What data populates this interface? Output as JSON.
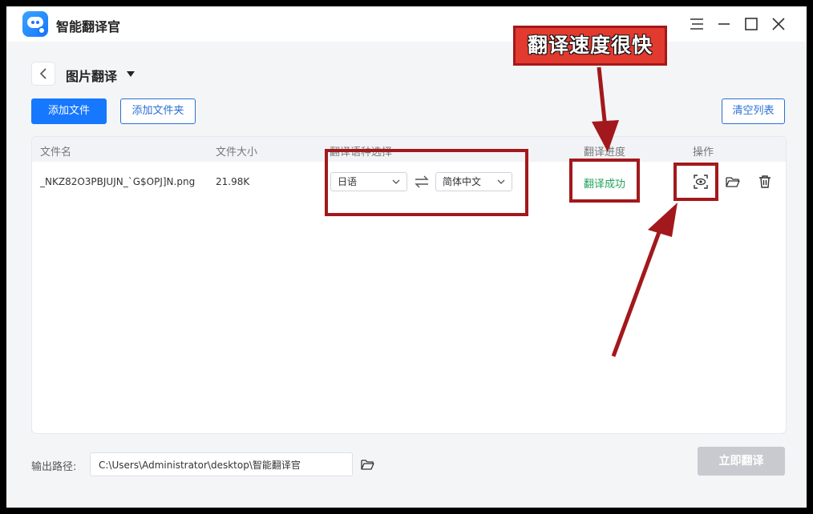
{
  "app": {
    "title": "智能翻译官",
    "window_controls": [
      "menu-icon",
      "minimize-icon",
      "maximize-icon",
      "close-icon"
    ]
  },
  "page": {
    "title": "图片翻译",
    "toolbar": {
      "add_file": "添加文件",
      "add_folder": "添加文件夹",
      "clear_list": "清空列表"
    }
  },
  "table": {
    "columns": [
      "文件名",
      "文件大小",
      "翻译语种选择",
      "翻译进度",
      "操作"
    ],
    "rows": [
      {
        "filename": "_NKZ82O3PBJUJN_`G$OPJ]N.png",
        "size": "21.98K",
        "source_lang": "日语",
        "target_lang": "简体中文",
        "status": "翻译成功",
        "actions": [
          "preview-icon",
          "open-folder-icon",
          "delete-icon"
        ]
      }
    ]
  },
  "footer": {
    "output_label": "输出路径:",
    "output_path": "C:\\Users\\Administrator\\desktop\\智能翻译官",
    "translate_button": "立即翻译"
  },
  "annotation": {
    "banner_text": "翻译速度很快"
  },
  "colors": {
    "primary": "#1677ff",
    "success": "#22a35a",
    "annotation": "#a3181c",
    "disabled": "#c8cacf"
  }
}
